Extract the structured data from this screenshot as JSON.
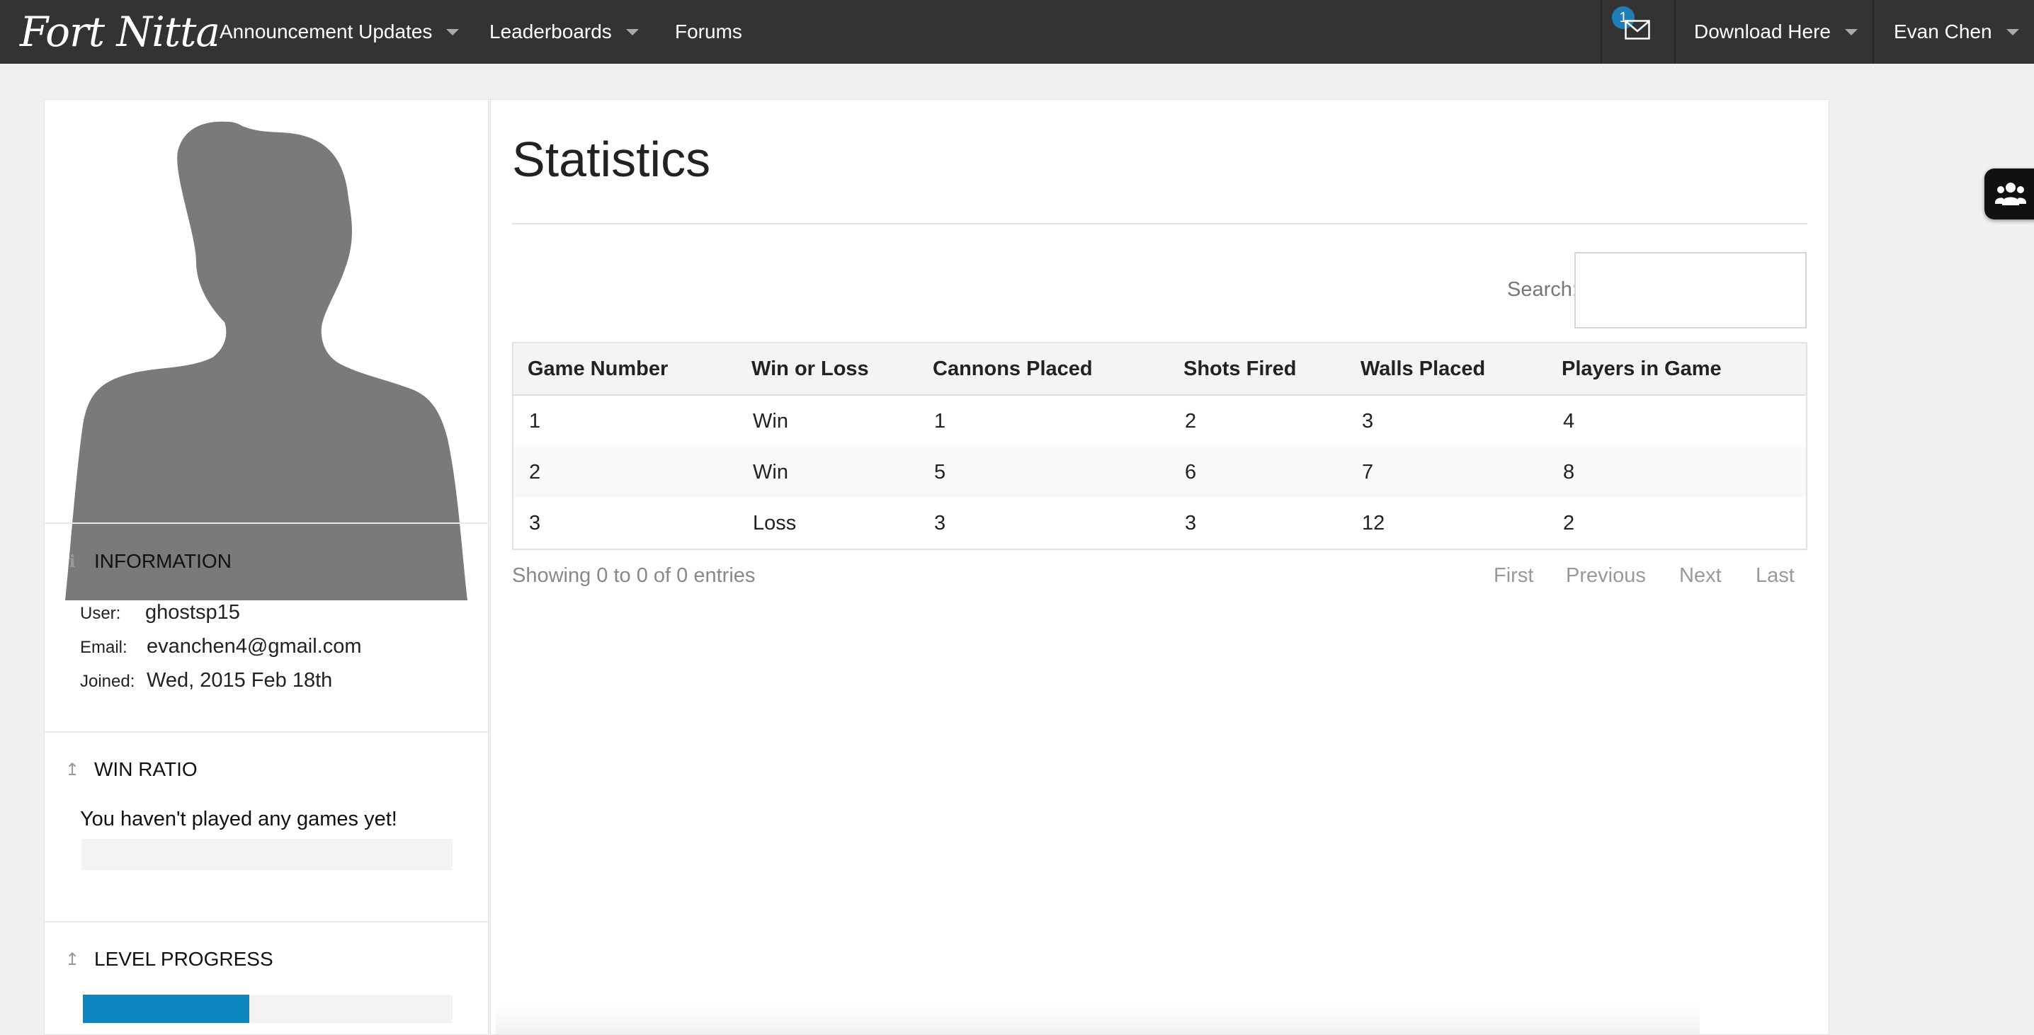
{
  "nav": {
    "brand": "Fort Nitta",
    "announcements": "Announcement Updates",
    "leaderboards": "Leaderboards",
    "forums": "Forums",
    "mail_badge": "1",
    "download": "Download Here",
    "user": "Evan Chen"
  },
  "sidebar": {
    "information": {
      "heading": "INFORMATION",
      "user_label": "User:",
      "user_value": "ghostsp15",
      "email_label": "Email:",
      "email_value": "evanchen4@gmail.com",
      "joined_label": "Joined:",
      "joined_value": "Wed, 2015 Feb 18th"
    },
    "win_ratio": {
      "heading": "WIN RATIO",
      "message": "You haven't played any games yet!",
      "progress": 0
    },
    "level_progress": {
      "heading": "LEVEL PROGRESS",
      "progress": 0.45
    }
  },
  "main": {
    "title": "Statistics",
    "search_label": "Search:",
    "search_value": "",
    "columns": [
      "Game Number",
      "Win or Loss",
      "Cannons Placed",
      "Shots Fired",
      "Walls Placed",
      "Players in Game"
    ],
    "rows": [
      [
        "1",
        "Win",
        "1",
        "2",
        "3",
        "4"
      ],
      [
        "2",
        "Win",
        "5",
        "6",
        "7",
        "8"
      ],
      [
        "3",
        "Loss",
        "3",
        "3",
        "12",
        "2"
      ]
    ],
    "showing": "Showing 0 to 0 of 0 entries",
    "pager": {
      "first": "First",
      "previous": "Previous",
      "next": "Next",
      "last": "Last"
    }
  },
  "colors": {
    "navbar": "#333333",
    "accent": "#0c86be",
    "badge": "#1f7eb5"
  },
  "icons": {
    "mail": "envelope-icon",
    "info": "info-icon",
    "win": "arrow-up-icon",
    "level": "arrow-up-icon",
    "widget": "users-icon"
  }
}
